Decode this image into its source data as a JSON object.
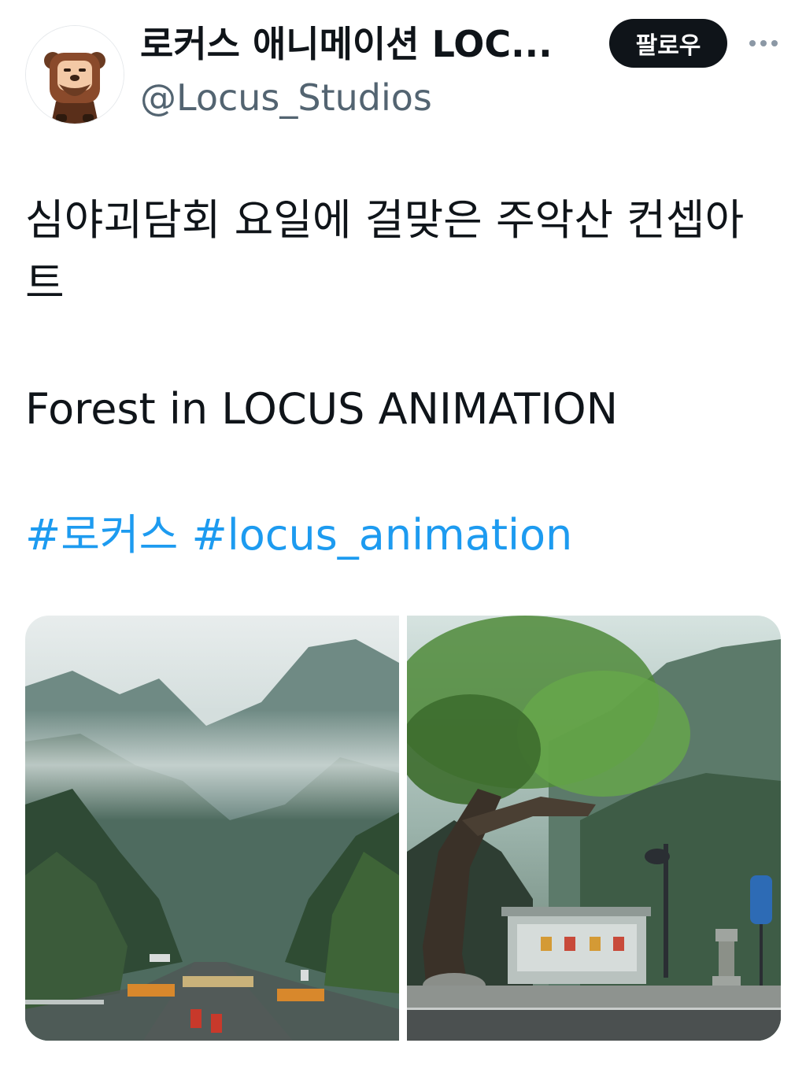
{
  "header": {
    "display_name": "로커스 애니메이션 LOC...",
    "handle": "@Locus_Studios",
    "follow_label": "팔로우",
    "avatar_icon": "bear-mascot-avatar-icon",
    "more_icon": "more-dots-icon"
  },
  "tweet": {
    "line_ko": "심야괴담회 요일에 걸맞은 주악산 컨셉아트",
    "line_en": "Forest in LOCUS ANIMATION",
    "hashtags": [
      "#로커스",
      "#locus_animation"
    ]
  },
  "media": [
    {
      "label": "misty-mountain-road-concept-art"
    },
    {
      "label": "bus-stop-under-tree-concept-art"
    }
  ],
  "colors": {
    "text": "#0f1419",
    "secondary": "#536471",
    "link": "#1d9bf0",
    "follow_bg": "#0f1419"
  }
}
